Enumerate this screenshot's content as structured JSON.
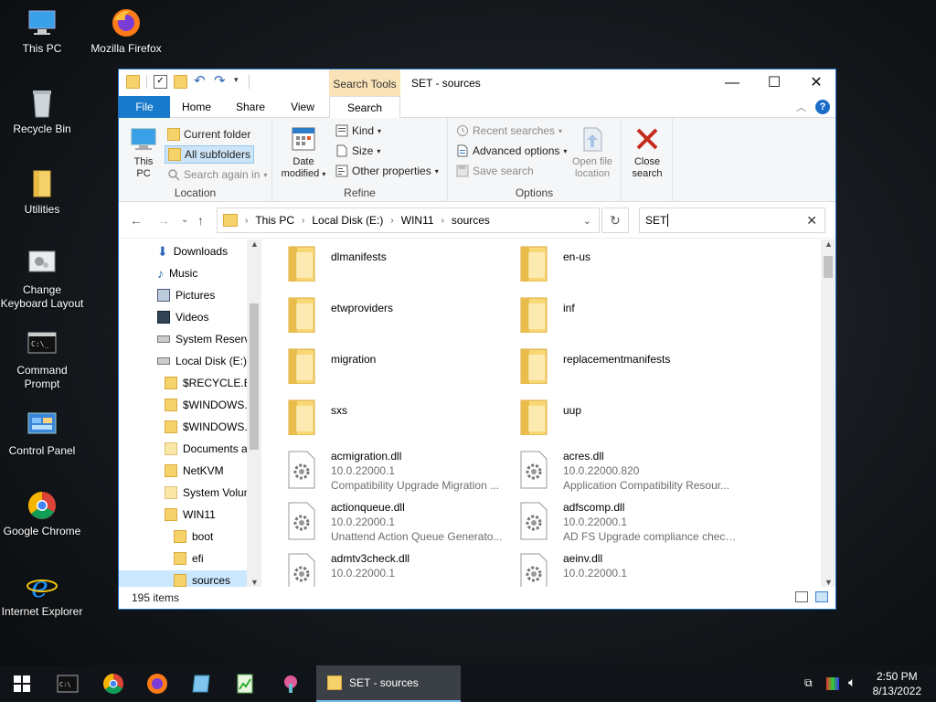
{
  "desktop": {
    "icons": [
      {
        "label": "This PC"
      },
      {
        "label": "Mozilla Firefox"
      },
      {
        "label": "Recycle Bin"
      },
      {
        "label": "Utilities"
      },
      {
        "label": "Change Keyboard Layout"
      },
      {
        "label": "Command Prompt"
      },
      {
        "label": "Control Panel"
      },
      {
        "label": "Google Chrome"
      },
      {
        "label": "Internet Explorer"
      }
    ]
  },
  "window": {
    "context_tab": "Search Tools",
    "title": "SET - sources",
    "tabs": {
      "file": "File",
      "home": "Home",
      "share": "Share",
      "view": "View",
      "search": "Search"
    },
    "ribbon": {
      "location": {
        "label": "Location",
        "this_pc": "This PC",
        "current_folder": "Current folder",
        "all_subfolders": "All subfolders",
        "search_again": "Search again in"
      },
      "refine": {
        "label": "Refine",
        "date_modified": "Date modified",
        "kind": "Kind",
        "size": "Size",
        "other_properties": "Other properties"
      },
      "options": {
        "label": "Options",
        "recent_searches": "Recent searches",
        "advanced_options": "Advanced options",
        "save_search": "Save search",
        "open_file_location": "Open file location"
      },
      "close_search": "Close search"
    },
    "address": {
      "segments": [
        "This PC",
        "Local Disk (E:)",
        "WIN11",
        "sources"
      ]
    },
    "search": {
      "value": "SET"
    },
    "nav_pane": [
      {
        "label": "Downloads"
      },
      {
        "label": "Music"
      },
      {
        "label": "Pictures"
      },
      {
        "label": "Videos"
      },
      {
        "label": "System Reserve"
      },
      {
        "label": "Local Disk (E:)"
      },
      {
        "label": "$RECYCLE.BIN"
      },
      {
        "label": "$WINDOWS.~"
      },
      {
        "label": "$WINDOWS.~"
      },
      {
        "label": "Documents a"
      },
      {
        "label": "NetKVM"
      },
      {
        "label": "System Volun"
      },
      {
        "label": "WIN11"
      },
      {
        "label": "boot"
      },
      {
        "label": "efi"
      },
      {
        "label": "sources"
      }
    ],
    "items": [
      {
        "name": "dlmanifests",
        "version": "",
        "desc": ""
      },
      {
        "name": "en-us",
        "version": "",
        "desc": ""
      },
      {
        "name": "etwproviders",
        "version": "",
        "desc": ""
      },
      {
        "name": "inf",
        "version": "",
        "desc": ""
      },
      {
        "name": "migration",
        "version": "",
        "desc": ""
      },
      {
        "name": "replacementmanifests",
        "version": "",
        "desc": ""
      },
      {
        "name": "sxs",
        "version": "",
        "desc": ""
      },
      {
        "name": "uup",
        "version": "",
        "desc": ""
      },
      {
        "name": "acmigration.dll",
        "version": "10.0.22000.1",
        "desc": "Compatibility Upgrade Migration ..."
      },
      {
        "name": "acres.dll",
        "version": "10.0.22000.820",
        "desc": "Application Compatibility Resour..."
      },
      {
        "name": "actionqueue.dll",
        "version": "10.0.22000.1",
        "desc": "Unattend Action Queue Generato..."
      },
      {
        "name": "adfscomp.dll",
        "version": "10.0.22000.1",
        "desc": "AD FS Upgrade compliance check..."
      },
      {
        "name": "admtv3check.dll",
        "version": "10.0.22000.1",
        "desc": ""
      },
      {
        "name": "aeinv.dll",
        "version": "10.0.22000.1",
        "desc": ""
      }
    ],
    "status": {
      "count": "195 items"
    }
  },
  "taskbar": {
    "active_window": "SET - sources",
    "time": "2:50 PM",
    "date": "8/13/2022"
  }
}
